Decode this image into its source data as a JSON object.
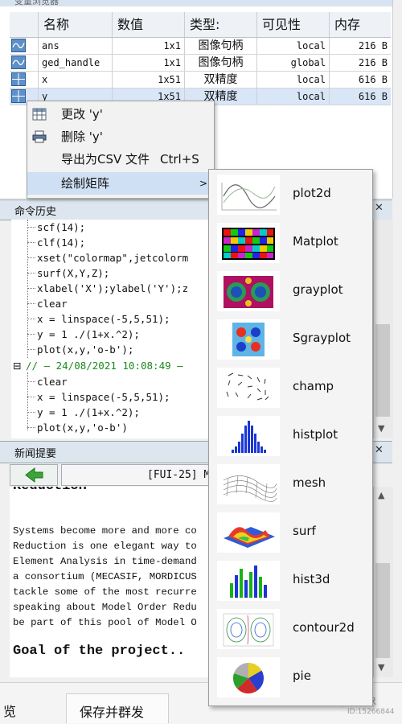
{
  "variable_browser": {
    "title": "变量浏览器",
    "columns": [
      "名称",
      "数值",
      "类型:",
      "可见性",
      "内存"
    ],
    "rows": [
      {
        "name": "ans",
        "value": "1x1",
        "type": "图像句柄",
        "visibility": "local",
        "memory": "216 B"
      },
      {
        "name": "ged_handle",
        "value": "1x1",
        "type": "图像句柄",
        "visibility": "global",
        "memory": "216 B"
      },
      {
        "name": "x",
        "value": "1x51",
        "type": "双精度",
        "visibility": "local",
        "memory": "616 B"
      },
      {
        "name": "y",
        "value": "1x51",
        "type": "双精度",
        "visibility": "local",
        "memory": "616 B"
      }
    ]
  },
  "context_menu": {
    "items": [
      {
        "label": "更改 'y'",
        "icon": "table-icon"
      },
      {
        "label": "删除 'y'",
        "icon": "printer-icon"
      },
      {
        "label": "导出为CSV 文件",
        "shortcut": "Ctrl+S"
      },
      {
        "label": "绘制矩阵",
        "arrow": ">"
      }
    ]
  },
  "command_history": {
    "title": "命令历史",
    "lines": [
      "scf(14);",
      "clf(14);",
      "xset(\"colormap\",jetcolorm",
      "surf(X,Y,Z);",
      "xlabel('X');ylabel('Y');z",
      "clear",
      "x = linspace(-5,5,51);",
      "y = 1 ./(1+x.^2);",
      "plot(x,y,'o-b');"
    ],
    "session": "// — 24/08/2021 10:08:49 —",
    "session_lines": [
      "clear",
      "x = linspace(-5,5,51);",
      "y = 1 ./(1+x.^2);",
      "plot(x,y,'o-b')"
    ],
    "collapse_symbol": "⊟"
  },
  "news_feed": {
    "title": "新闻提要",
    "nav_text": "[FUI-25] M",
    "heading_partial": "Reduction",
    "paragraph": [
      "Systems become more and more co",
      "Reduction is one elegant way to",
      "Element Analysis in time-demand",
      "a consortium (MECASIF, MORDICUS",
      "tackle some of the most recurre",
      "speaking about Model Order Redu",
      "be part of this pool of Model O"
    ],
    "goal": "Goal of the project.."
  },
  "plot_submenu": {
    "items": [
      "plot2d",
      "Matplot",
      "grayplot",
      "Sgrayplot",
      "champ",
      "histplot",
      "mesh",
      "surf",
      "hist3d",
      "contour2d",
      "pie"
    ]
  },
  "bottom_bar": {
    "left_text": "览",
    "tab_label": "保存并群发",
    "watermark": "繁华落尽",
    "watermark_id": "ID:15266844"
  },
  "close_symbol": "✕"
}
